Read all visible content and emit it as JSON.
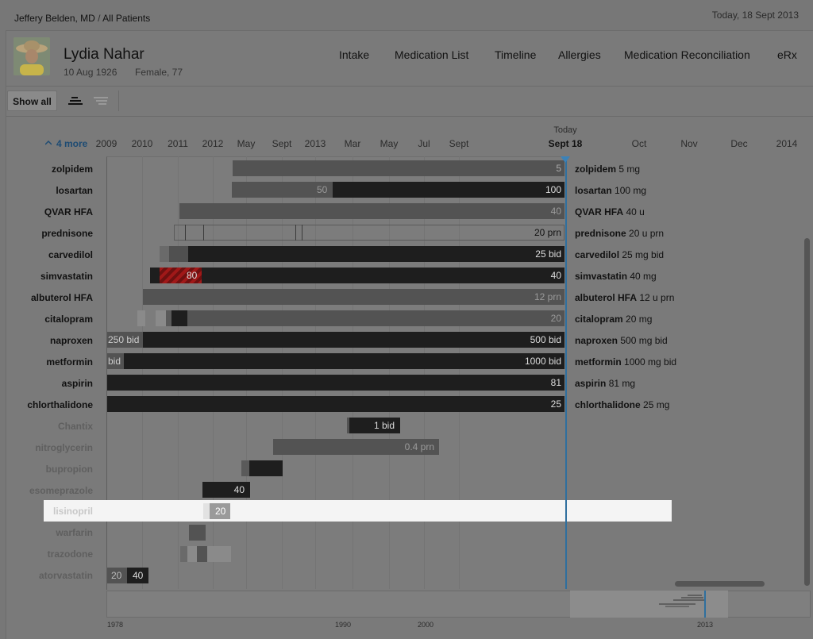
{
  "topbar": {
    "doctor": "Jeffery Belden, MD",
    "separator": " / ",
    "scope": "All Patients",
    "today": "Today, 18 Sept  2013"
  },
  "patient": {
    "name": "Lydia Nahar",
    "dob": "10 Aug 1926",
    "sex_age": "Female, 77"
  },
  "nav": [
    "Intake",
    "Medication List",
    "Timeline",
    "Allergies",
    "Medication Reconciliation",
    "eRx"
  ],
  "toolbar": {
    "show_all": "Show all"
  },
  "timeline": {
    "more_label": "4 more",
    "today_label": "Today",
    "today_date": "Sept 18",
    "ticks": [
      "2009",
      "2010",
      "2011",
      "2012",
      "May",
      "Sept",
      "2013",
      "Mar",
      "May",
      "Jul",
      "Sept",
      "Oct",
      "Nov",
      "Dec",
      "2014"
    ]
  },
  "medications": [
    {
      "name": "zolpidem",
      "status": "current",
      "summary_name": "zolpidem",
      "summary_dose": "5 mg",
      "dose_labels": [
        "5"
      ]
    },
    {
      "name": "losartan",
      "status": "current",
      "summary_name": "losartan",
      "summary_dose": "100 mg",
      "dose_labels": [
        "50",
        "100"
      ]
    },
    {
      "name": "QVAR HFA",
      "status": "current",
      "summary_name": "QVAR HFA",
      "summary_dose": "40 u",
      "dose_labels": [
        "40"
      ]
    },
    {
      "name": "prednisone",
      "status": "current",
      "summary_name": "prednisone",
      "summary_dose": "20 u prn",
      "dose_labels": [
        "20 prn"
      ]
    },
    {
      "name": "carvedilol",
      "status": "current",
      "summary_name": "carvedilol",
      "summary_dose": " 25 mg bid",
      "dose_labels": [
        "25 bid"
      ]
    },
    {
      "name": "simvastatin",
      "status": "current",
      "summary_name": "simvastatin",
      "summary_dose": "40 mg",
      "dose_labels": [
        "80",
        "40"
      ]
    },
    {
      "name": "albuterol HFA",
      "status": "current",
      "summary_name": "albuterol HFA",
      "summary_dose": "12 u prn",
      "dose_labels": [
        "12 prn"
      ]
    },
    {
      "name": "citalopram",
      "status": "current",
      "summary_name": "citalopram",
      "summary_dose": "20 mg",
      "dose_labels": [
        "20"
      ]
    },
    {
      "name": "naproxen",
      "status": "current",
      "summary_name": "naproxen",
      "summary_dose": "500 mg bid",
      "dose_labels": [
        "250 bid",
        "500 bid"
      ]
    },
    {
      "name": "metformin",
      "status": "current",
      "summary_name": "metformin",
      "summary_dose": "1000 mg bid",
      "dose_labels": [
        "bid",
        "1000 bid"
      ]
    },
    {
      "name": "aspirin",
      "status": "current",
      "summary_name": "aspirin",
      "summary_dose": "81 mg",
      "dose_labels": [
        "81"
      ]
    },
    {
      "name": "chlorthalidone",
      "status": "current",
      "summary_name": "chlorthalidone",
      "summary_dose": "25 mg",
      "dose_labels": [
        "25"
      ]
    },
    {
      "name": "Chantix",
      "status": "past",
      "dose_labels": [
        "1 bid"
      ]
    },
    {
      "name": "nitroglycerin",
      "status": "past",
      "dose_labels": [
        "0.4 prn"
      ]
    },
    {
      "name": "bupropion",
      "status": "past",
      "dose_labels": []
    },
    {
      "name": "esomeprazole",
      "status": "past",
      "dose_labels": [
        "40"
      ]
    },
    {
      "name": "lisinopril",
      "status": "selected",
      "dose_labels": [
        "20"
      ]
    },
    {
      "name": "warfarin",
      "status": "past",
      "dose_labels": []
    },
    {
      "name": "trazodone",
      "status": "past",
      "dose_labels": []
    },
    {
      "name": "atorvastatin",
      "status": "past",
      "dose_labels": [
        "20",
        "40"
      ]
    }
  ],
  "overview": {
    "ticks": [
      "1978",
      "1990",
      "2000",
      "2013"
    ]
  },
  "colors": {
    "accent": "#3b82b8",
    "bar_dark": "#1e1e1e",
    "bar_mid": "#535353",
    "bar_light": "#9a9a9a",
    "warning_red": "#a01818",
    "highlight": "#f4f4f4"
  }
}
